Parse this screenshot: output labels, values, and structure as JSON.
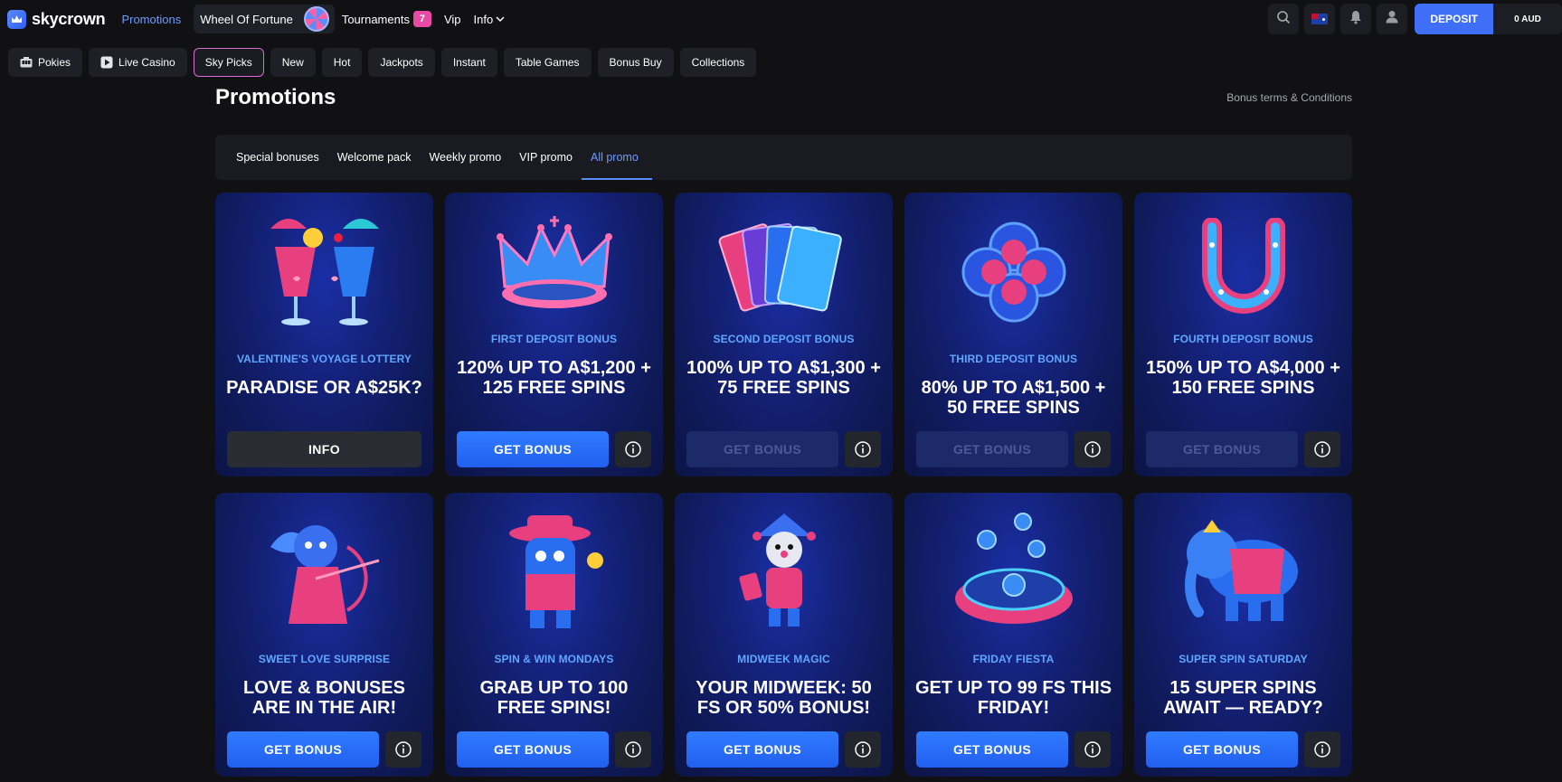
{
  "header": {
    "brand": "skycrown",
    "nav": [
      {
        "label": "Promotions",
        "active": true
      },
      {
        "label": "Wheel Of Fortune"
      },
      {
        "label": "Tournaments",
        "badge": "7"
      },
      {
        "label": "Vip"
      },
      {
        "label": "Info"
      }
    ],
    "deposit_label": "DEPOSIT",
    "balance": "0 AUD",
    "icons": [
      "search-icon",
      "flag-au-icon",
      "bell-icon",
      "user-icon"
    ]
  },
  "categories": [
    {
      "label": "Pokies",
      "icon": "pokies-icon"
    },
    {
      "label": "Live Casino",
      "icon": "play-icon"
    },
    {
      "label": "Sky Picks",
      "selected": true
    },
    {
      "label": "New"
    },
    {
      "label": "Hot"
    },
    {
      "label": "Jackpots"
    },
    {
      "label": "Instant"
    },
    {
      "label": "Table Games"
    },
    {
      "label": "Bonus Buy"
    },
    {
      "label": "Collections"
    }
  ],
  "page": {
    "title": "Promotions",
    "terms_link": "Bonus terms & Conditions"
  },
  "tabs": [
    {
      "label": "Special bonuses"
    },
    {
      "label": "Welcome pack"
    },
    {
      "label": "Weekly promo"
    },
    {
      "label": "VIP promo"
    },
    {
      "label": "All promo",
      "active": true
    }
  ],
  "promos": [
    {
      "subtitle": "VALENTINE'S VOYAGE LOTTERY",
      "headline": "PARADISE OR A$25K?",
      "button": "INFO",
      "kind": "info",
      "art": "cocktails-art"
    },
    {
      "subtitle": "FIRST DEPOSIT BONUS",
      "headline": "120% UP TO A$1,200 + 125 FREE SPINS",
      "button": "GET BONUS",
      "kind": "active",
      "art": "crown-art"
    },
    {
      "subtitle": "SECOND DEPOSIT BONUS",
      "headline": "100% UP TO A$1,300 + 75 FREE SPINS",
      "button": "GET BONUS",
      "kind": "disabled",
      "art": "cards-art"
    },
    {
      "subtitle": "THIRD DEPOSIT BONUS",
      "headline": "80% UP TO A$1,500 + 50 FREE SPINS",
      "button": "GET BONUS",
      "kind": "disabled",
      "art": "clover-art"
    },
    {
      "subtitle": "FOURTH DEPOSIT BONUS",
      "headline": "150% UP TO A$4,000 + 150 FREE SPINS",
      "button": "GET BONUS",
      "kind": "disabled",
      "art": "horseshoe-art"
    },
    {
      "subtitle": "SWEET LOVE SURPRISE",
      "headline": "LOVE & BONUSES ARE IN THE AIR!",
      "button": "GET BONUS",
      "kind": "active",
      "art": "cupid-art"
    },
    {
      "subtitle": "SPIN & WIN MONDAYS",
      "headline": "GRAB UP TO 100 FREE SPINS!",
      "button": "GET BONUS",
      "kind": "active",
      "art": "cowboy-art"
    },
    {
      "subtitle": "MIDWEEK MAGIC",
      "headline": "YOUR MIDWEEK: 50 FS OR 50% BONUS!",
      "button": "GET BONUS",
      "kind": "active",
      "art": "jester-art"
    },
    {
      "subtitle": "FRIDAY FIESTA",
      "headline": "GET UP TO 99 FS THIS FRIDAY!",
      "button": "GET BONUS",
      "kind": "active",
      "art": "coin-portal-art"
    },
    {
      "subtitle": "SUPER SPIN SATURDAY",
      "headline": "15 SUPER SPINS AWAIT — READY?",
      "button": "GET BONUS",
      "kind": "active",
      "art": "elephant-art"
    }
  ],
  "colors": {
    "background": "#111114",
    "accent": "#3f6ff6",
    "subtitle": "#5fa6ff",
    "active_tab": "#6f9bff",
    "badge": "#e94aa5"
  }
}
